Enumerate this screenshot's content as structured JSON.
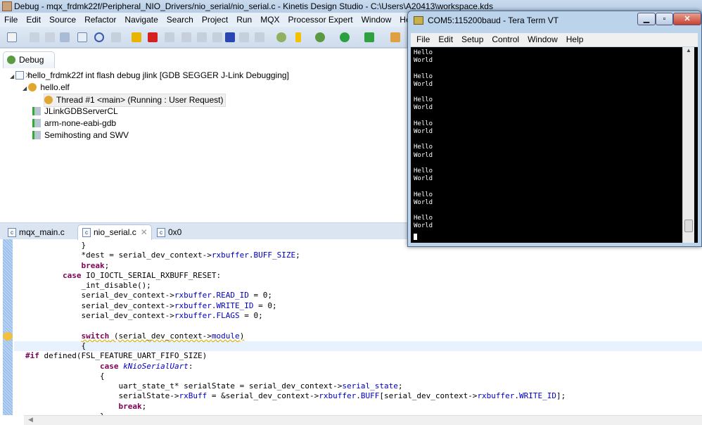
{
  "window_title": "Debug - mqx_frdmk22f/Peripheral_NIO_Drivers/nio_serial/nio_serial.c - Kinetis Design Studio - C:\\Users\\A20413\\workspace.kds",
  "menu": [
    "File",
    "Edit",
    "Source",
    "Refactor",
    "Navigate",
    "Search",
    "Project",
    "Run",
    "MQX",
    "Processor Expert",
    "Window",
    "Help"
  ],
  "debug_view": {
    "tab_label": "Debug",
    "tree": [
      {
        "label": "hello_frdmk22f int flash debug jlink [GDB SEGGER J-Link Debugging]",
        "icon": "c-launch-icon"
      },
      {
        "label": "hello.elf",
        "icon": "process-icon"
      },
      {
        "label": "Thread #1 <main> (Running : User Request)",
        "icon": "thread-running-icon"
      },
      {
        "label": "JLinkGDBServerCL",
        "icon": "server-icon"
      },
      {
        "label": "arm-none-eabi-gdb",
        "icon": "server-icon"
      },
      {
        "label": "Semihosting and SWV",
        "icon": "server-icon"
      }
    ]
  },
  "editor": {
    "tabs": [
      {
        "label": "mqx_main.c"
      },
      {
        "label": "nio_serial.c",
        "active": true
      },
      {
        "label": "0x0"
      }
    ]
  },
  "teraterm": {
    "title": "COM5:115200baud - Tera Term VT",
    "menu": [
      "File",
      "Edit",
      "Setup",
      "Control",
      "Window",
      "Help"
    ],
    "output": "Hello\nWorld\n\nHello\nWorld\n\nHello\nWorld\n\nHello\nWorld\n\nHello\nWorld\n\nHello\nWorld\n\nHello\nWorld\n\nHello\nWorld"
  }
}
